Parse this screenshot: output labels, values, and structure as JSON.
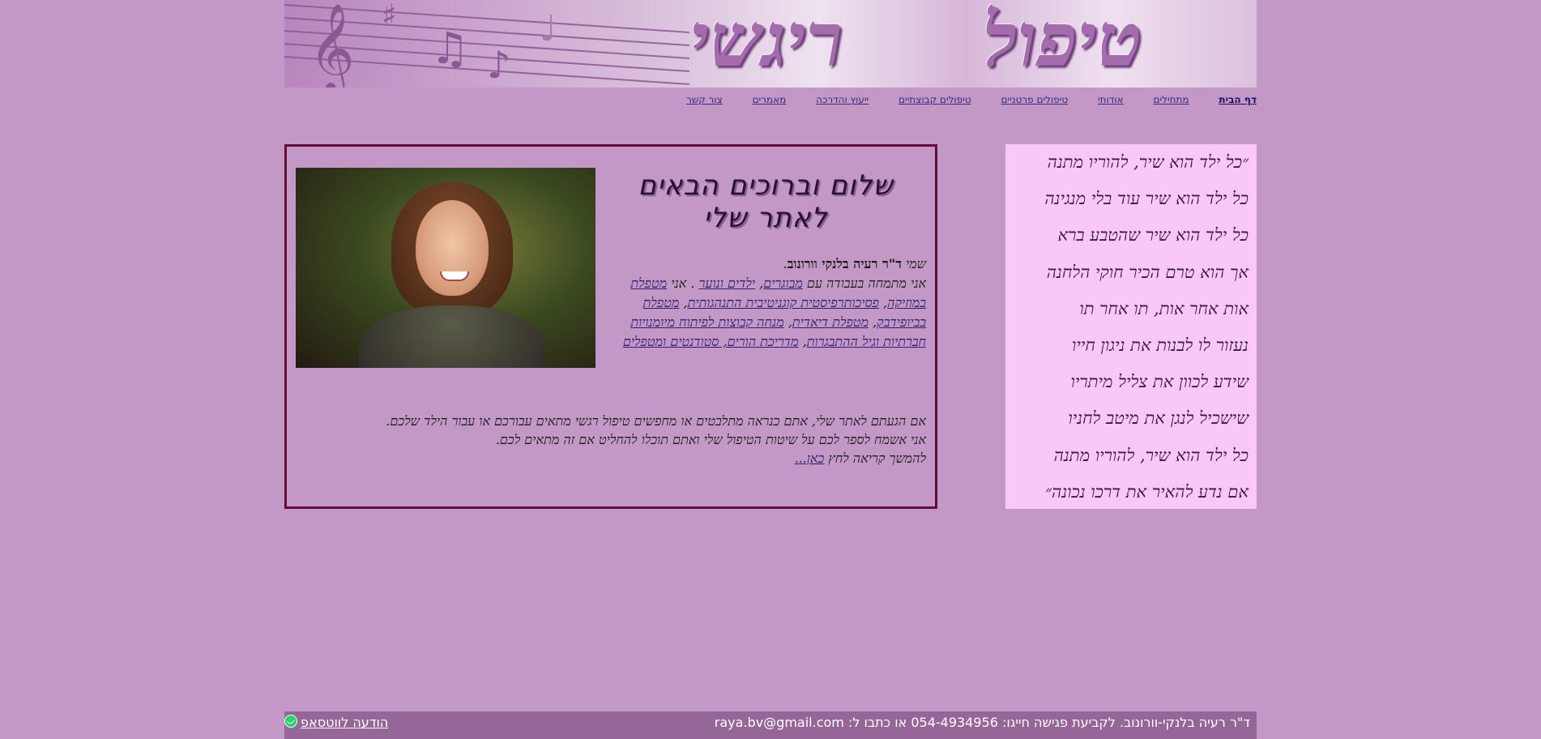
{
  "banner": {
    "title_word_1": "טיפול",
    "title_word_2": "ריגשי"
  },
  "nav": {
    "items": [
      {
        "label": "דף הבית",
        "active": true
      },
      {
        "label": "מתחילים"
      },
      {
        "label": "אודותי"
      },
      {
        "label": "טיפולים פרטניים"
      },
      {
        "label": "טיפולים קבוצתיים"
      },
      {
        "label": "ייעוץ והדרכה"
      },
      {
        "label": "מאמרים"
      },
      {
        "label": "צור קשר"
      }
    ]
  },
  "poem": {
    "lines": [
      "״כל ילד הוא שיר, להוריו מתנה",
      "כל ילד הוא שיר עוד בלי מנגינה",
      "כל ילד הוא שיר שהטבע ברא",
      "אך הוא טרם הכיר חוקי הלחנה",
      "אות אחר אות, תו אחר תו",
      "נעזור לו לבנות את ניגון חייו",
      "שידע לכוון את צליל מיתריו",
      "שישכיל לנגן את מיטב לחניו",
      "כל ילד הוא שיר, להוריו מתנה",
      "אם נדע להאיר את דרכו נכונה״"
    ]
  },
  "main": {
    "greeting": "שלום וברוכים הבאים לאתר שלי",
    "intro": {
      "name_prefix": "שמי ",
      "name": "ד\"ר רעיה בלנקי וורונוב",
      "name_suffix": ".",
      "line2_prefix": "אני מתמחה בעבודה עם ",
      "link_adults": "מבוגרים",
      "comma": ", ",
      "link_kids": "ילדים ונוער",
      "line2_suffix": " . אני",
      "link_music": "מטפלת במוזיקה",
      "link_cbt": "פסיכותרפיסטית קוגניטיבית התנהגותית",
      "link_biofeedback": "מטפלת בביופידבק",
      "link_dyadic": "מטפלת דיאדית",
      "link_groups": "מנחה קבוצות לפיתוח מיומנויות חברתיות וגיל ההתבגרות",
      "link_parents": "מדריכת הורים, סטודנטים ומטפלים"
    },
    "paragraph": {
      "line1": "אם הגעתם לאתר שלי, אתם כנראה מתלבטים או מחפשים טיפול רגשי מתאים עבורכם או עבור הילד שלכם.",
      "line2": "אני אשמח לספר לכם על שיטות הטיפול שלי ואתם תוכלו להחליט אם זה מתאים לכם.",
      "line3_prefix": "להמשך קריאה לחץ ",
      "link_here": "כאן..."
    }
  },
  "footer": {
    "contact": "ד\"ר רעיה בלנקי-וורונוב. לקביעת פגישה חייגו: 054-4934956 או כתבו ל: raya.bv@gmail.com",
    "whatsapp_label": "הודעה לווטסאפ"
  },
  "colors": {
    "page_bg": "#c398c6",
    "poem_bg": "#f9c8f8",
    "border": "#640c3a",
    "footer_bg": "#966698",
    "link": "#2c1f6e"
  }
}
